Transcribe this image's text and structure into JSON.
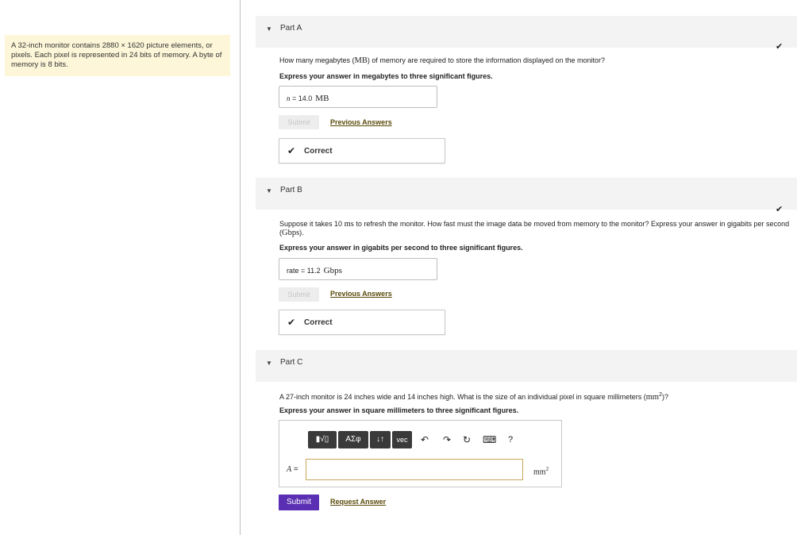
{
  "problem_text": "A 32-inch monitor contains 2880 × 1620 picture elements, or pixels. Each pixel is represented in 24 bits of memory. A byte of memory is 8 bits.",
  "partA": {
    "title": "Part A",
    "question_pre": "How many megabytes (",
    "question_unit": "MB",
    "question_post": ") of memory are required to store the information displayed on the monitor?",
    "instruction": "Express your answer in megabytes to three significant figures.",
    "answer_label": "n",
    "answer_eq": " = ",
    "answer_value": "14.0",
    "answer_unit": "MB",
    "submit": "Submit",
    "prev_answers": "Previous Answers",
    "feedback": "Correct"
  },
  "partB": {
    "title": "Part B",
    "question_pre": "Suppose it takes 10 ",
    "question_unit1": "ms",
    "question_mid": " to refresh the monitor. How fast must the image data be moved from memory to the monitor? Express your answer in gigabits per second (",
    "question_unit2": "Gbps",
    "question_post": ").",
    "instruction": "Express your answer in gigabits per second to three significant figures.",
    "answer_label": "rate",
    "answer_eq": " = ",
    "answer_value": "11.2",
    "answer_unit": "Gbps",
    "submit": "Submit",
    "prev_answers": "Previous Answers",
    "feedback": "Correct"
  },
  "partC": {
    "title": "Part C",
    "question_pre": "A 27-inch monitor is 24 inches wide and 14 inches high. What is the size of an individual pixel in square millimeters (",
    "question_unit": "mm",
    "question_sup": "2",
    "question_post": ")?",
    "instruction": "Express your answer in square millimeters to three significant figures.",
    "toolbar": {
      "templates": "▮√▯",
      "greek": "ΑΣφ",
      "arrows": "↓↑",
      "vec": "vec",
      "undo": "↶",
      "redo": "↷",
      "reset": "↻",
      "keyboard": "⌨",
      "help": "?"
    },
    "answer_label": "A",
    "answer_eq": " =",
    "answer_value": "",
    "answer_unit": "mm",
    "answer_unit_sup": "2",
    "submit": "Submit",
    "request_answer": "Request Answer"
  },
  "icons": {
    "collapse": "▼",
    "check": "✔"
  },
  "colors": {
    "submit_active": "#5b2fb3",
    "problem_bg": "#fdf6d8",
    "input_border": "#c7a75a"
  }
}
